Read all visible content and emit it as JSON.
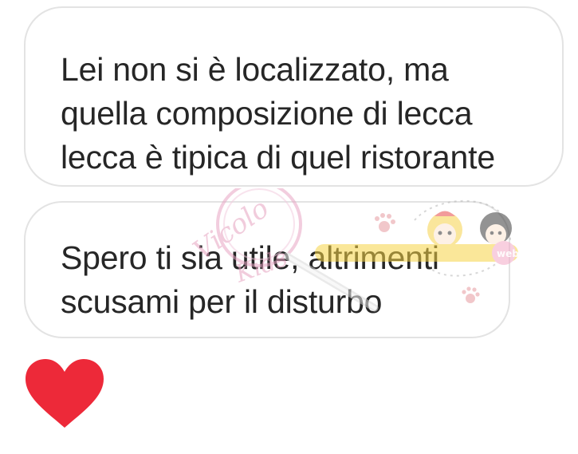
{
  "messages": [
    {
      "lines": [
        "Lei non si è localizzato, ma",
        "quella composizione di lecca",
        "lecca è tipica di quel ristorante"
      ]
    },
    {
      "lines": [
        "Spero ti sia utile, altrimenti",
        "scusami per il disturbo"
      ]
    }
  ],
  "reaction": {
    "icon": "heart-icon",
    "color": "#ed2939"
  },
  "watermark": {
    "text": "Vicolo Kids",
    "badge": "web"
  },
  "colors": {
    "bubble_border": "#e3e3e3",
    "text": "#262626",
    "background": "#ffffff"
  }
}
